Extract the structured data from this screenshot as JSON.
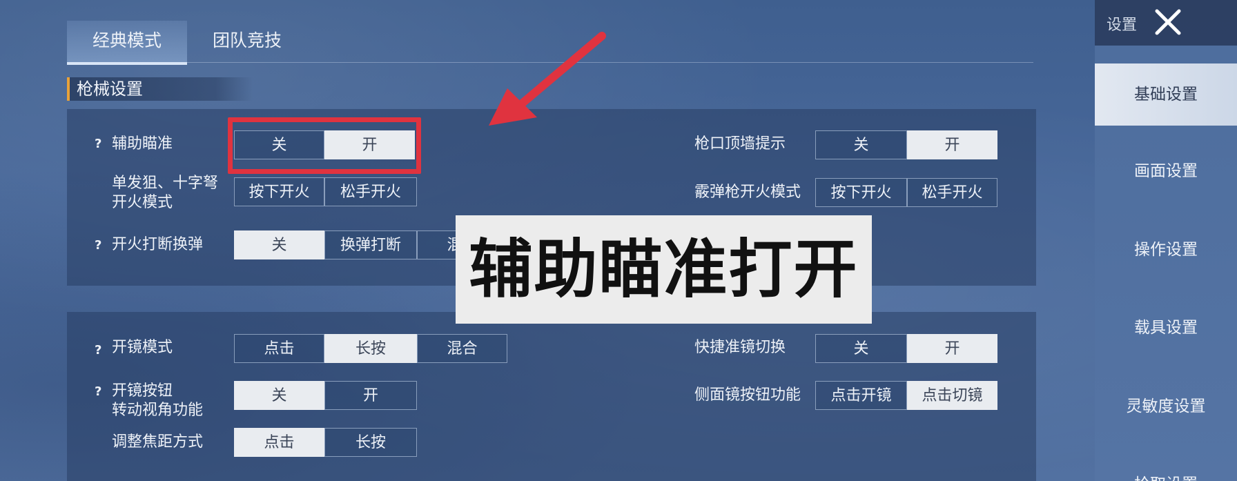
{
  "tabs": [
    {
      "label": "经典模式",
      "active": true
    },
    {
      "label": "团队竞技",
      "active": false
    }
  ],
  "section_title": "枪械设置",
  "panel1": {
    "left": [
      {
        "label": "辅助瞄准",
        "help": "?",
        "options": [
          "关",
          "开"
        ],
        "selected": 1
      },
      {
        "label_lines": [
          "单发狙、十字弩",
          "开火模式"
        ],
        "options": [
          "按下开火",
          "松手开火"
        ],
        "selected": -1
      },
      {
        "label": "开火打断换弹",
        "help": "?",
        "options": [
          "关",
          "换弹打断",
          "混合"
        ],
        "selected": 0
      }
    ],
    "right": [
      {
        "label": "枪口顶墙提示",
        "options": [
          "关",
          "开"
        ],
        "selected": 1
      },
      {
        "label": "霰弹枪开火模式",
        "options": [
          "按下开火",
          "松手开火"
        ],
        "selected": -1
      }
    ]
  },
  "panel2": {
    "left": [
      {
        "label": "开镜模式",
        "help": "?",
        "options": [
          "点击",
          "长按",
          "混合"
        ],
        "selected": 1
      },
      {
        "label_lines": [
          "开镜按钮",
          "转动视角功能"
        ],
        "help": "?",
        "options": [
          "关",
          "开"
        ],
        "selected": 0
      },
      {
        "label": "调整焦距方式",
        "options": [
          "点击",
          "长按"
        ],
        "selected": 0
      }
    ],
    "right": [
      {
        "label": "快捷准镜切换",
        "options": [
          "关",
          "开"
        ],
        "selected": 1
      },
      {
        "label": "侧面镜按钮功能",
        "options": [
          "点击开镜",
          "点击切镜"
        ],
        "selected": 1
      }
    ]
  },
  "caption": "辅助瞄准打开",
  "sidebar": {
    "title": "设置",
    "items": [
      {
        "label": "基础设置",
        "active": true
      },
      {
        "label": "画面设置",
        "active": false
      },
      {
        "label": "操作设置",
        "active": false
      },
      {
        "label": "载具设置",
        "active": false
      },
      {
        "label": "灵敏度设置",
        "active": false
      },
      {
        "label": "拾取设置",
        "active": false
      }
    ]
  },
  "colors": {
    "highlight_red": "#e0333f",
    "selected_option": "#e9ecf0",
    "accent_orange": "#e8a23a"
  },
  "icons": [
    "close-icon",
    "help-icon",
    "arrow-annotation"
  ]
}
